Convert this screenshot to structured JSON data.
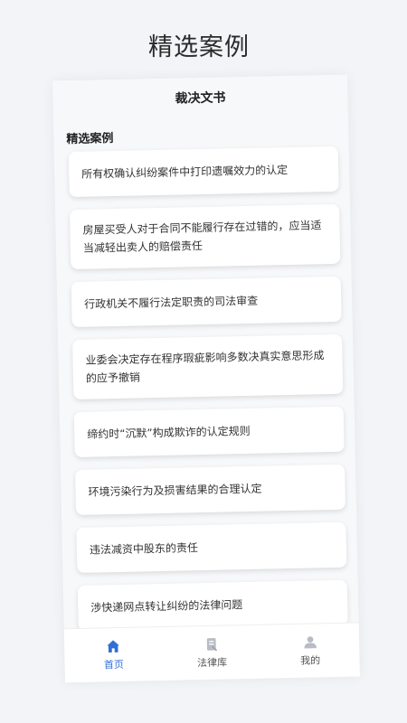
{
  "promo": {
    "title": "精选案例"
  },
  "header": {
    "title": "裁决文书"
  },
  "section": {
    "title": "精选案例"
  },
  "cases": [
    {
      "title": "所有权确认纠纷案件中打印遗嘱效力的认定",
      "lines": 1
    },
    {
      "title": "房屋买受人对于合同不能履行存在过错的，应当适当减轻出卖人的赔偿责任",
      "lines": 2
    },
    {
      "title": "行政机关不履行法定职责的司法审查",
      "lines": 1
    },
    {
      "title": "业委会决定存在程序瑕疵影响多数决真实意思形成的应予撤销",
      "lines": 2
    },
    {
      "title": "缔约时“沉默”构成欺诈的认定规则",
      "lines": 1
    },
    {
      "title": "环境污染行为及损害结果的合理认定",
      "lines": 1
    },
    {
      "title": "违法减资中股东的责任",
      "lines": 1
    },
    {
      "title": "涉快递网点转让纠纷的法律问题",
      "lines": 1
    }
  ],
  "tabbar": {
    "items": [
      {
        "label": "首页",
        "icon": "home-icon",
        "active": true
      },
      {
        "label": "法律库",
        "icon": "law-library-icon",
        "active": false
      },
      {
        "label": "我的",
        "icon": "user-icon",
        "active": false
      }
    ]
  },
  "colors": {
    "accent": "#2f6fd6",
    "inactive_icon": "#b8bcc4"
  }
}
